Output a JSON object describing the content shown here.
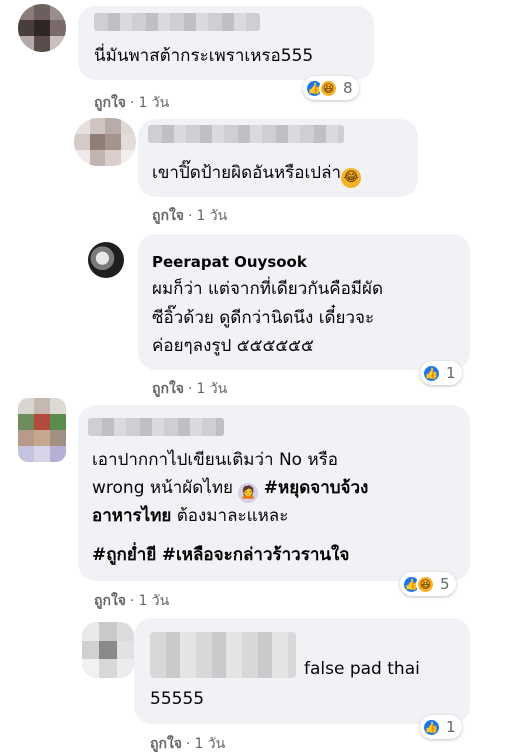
{
  "comments": [
    {
      "text_lines": [
        "นี่มันพาสต้ากระเพราเหรอ555"
      ],
      "like_label": "ถูกใจ",
      "time": "1 วัน",
      "reaction_count": "8"
    },
    {
      "text_lines": [
        "เขาปิ๊ดป้ายผิดอันหรือเปล่า"
      ],
      "like_label": "ถูกใจ",
      "time": "1 วัน"
    },
    {
      "name": "Peerapat Ouysook",
      "text_lines": [
        "ผมก็ว่า แต่จากที่เดียวกันคือมีผัด",
        "ซีอิ๊วด้วย ดูดีกว่านิดนึง เดี๋ยวจะ",
        "ค่อยๆลงรูป ๕๕๕๕๕๕"
      ],
      "like_label": "ถูกใจ",
      "time": "1 วัน",
      "reaction_count": "1"
    },
    {
      "line1": "เอาปากกาไปเขียนเติมว่า No หรือ",
      "line2_a": "wrong หน้าผัดไทย",
      "hashtag1_a": "#หยุดจาบจ้วง",
      "hashtag1_b": "อาหารไทย",
      "line3_rest": "ต้องมาละแหละ",
      "hashtag2": "#ถูกย่ำยี",
      "hashtag3": "#เหลือจะกล่าวร้าวรานใจ",
      "like_label": "ถูกใจ",
      "time": "1 วัน",
      "reaction_count": "5"
    },
    {
      "text_lines": [
        "false pad thai",
        "55555"
      ],
      "like_label": "ถูกใจ",
      "time": "1 วัน",
      "reaction_count": "1"
    }
  ],
  "icons": {
    "like": "like-reaction-icon",
    "haha": "haha-reaction-icon"
  },
  "colors": {
    "bubble": "#f0f2f5",
    "meta": "#65676b",
    "like_blue": "#1877f2",
    "haha_yellow": "#f7b125"
  }
}
